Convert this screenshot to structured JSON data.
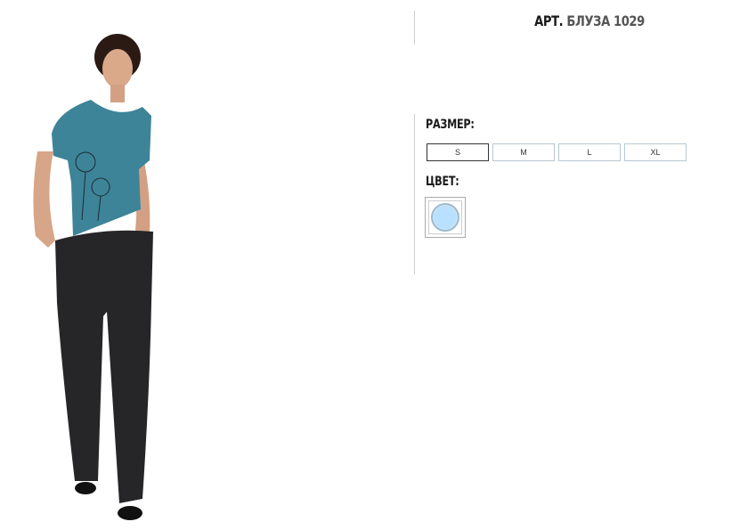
{
  "product": {
    "title_prefix": "АРТ.",
    "title_code": "БЛУЗА 1029"
  },
  "size": {
    "label": "РАЗМЕР:",
    "options": [
      "S",
      "M",
      "L",
      "XL"
    ],
    "selected": "S"
  },
  "color": {
    "label": "ЦВЕТ:",
    "swatch_hex": "#b9e1ff"
  },
  "photo": {
    "icon": "model-photo",
    "top_color": "#3d8499",
    "pants_color": "#262528"
  }
}
